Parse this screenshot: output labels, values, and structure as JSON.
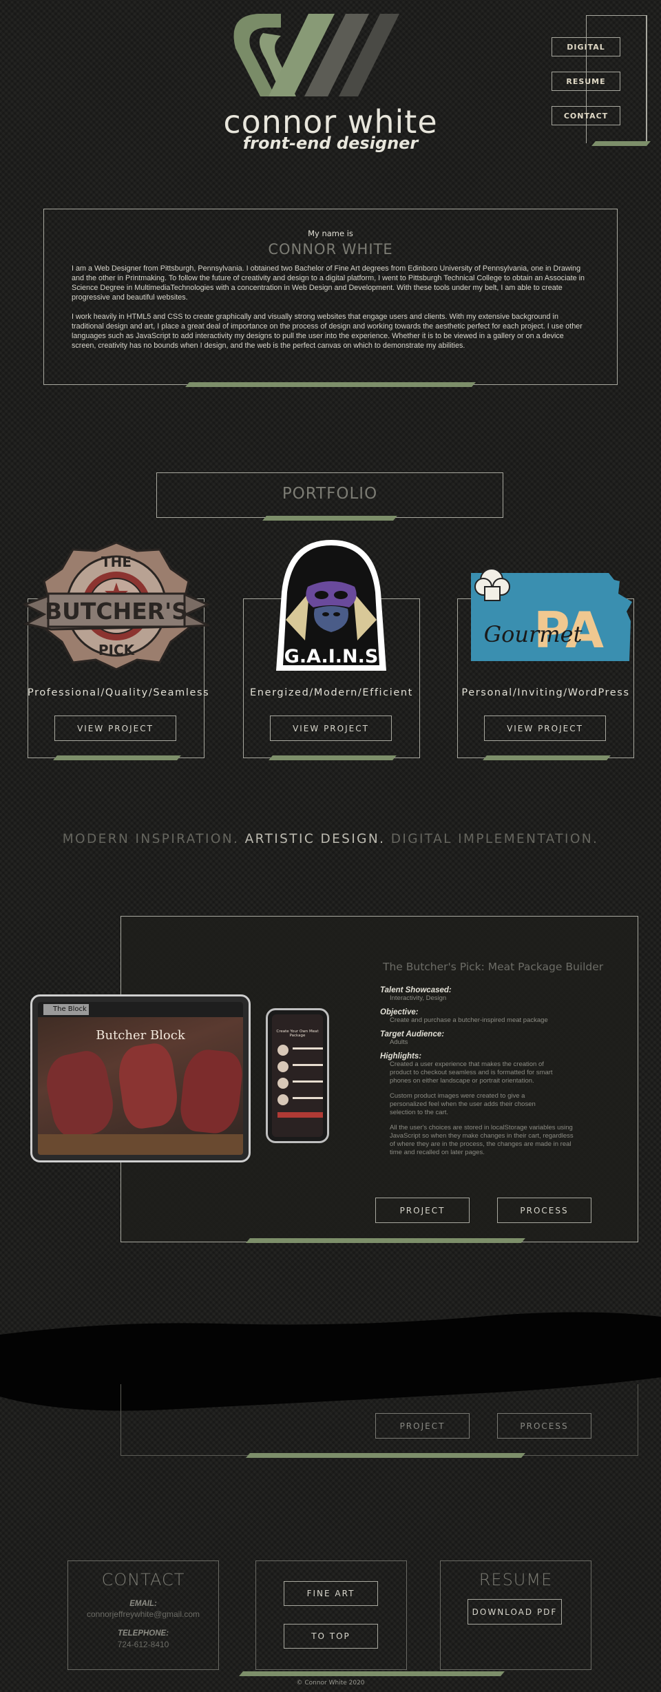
{
  "header": {
    "name": "connor white",
    "subtitle": "front-end designer",
    "nav": [
      "DIGITAL",
      "RESUME",
      "CONTACT"
    ]
  },
  "about": {
    "intro": "My name is",
    "name": "CONNOR WHITE",
    "paragraph1": "I am a Web Designer from Pittsburgh, Pennsylvania. I obtained two Bachelor of Fine Art degrees from Edinboro University of Pennsylvania, one in Drawing and the other in Printmaking. To follow the future of creativity and design to a digital platform, I went to Pittsburgh Technical College to obtain an Associate in Science Degree in MultimediaTechnologies with a concentration in Web Design and Development.  With these tools under my belt, I am able to create progressive and beautiful websites.",
    "paragraph2": "I work heavily in HTML5 and CSS to create graphically and visually strong websites that engage users and clients. With my extensive background in traditional design and art, I place a great deal of importance on the process of design and working towards the aesthetic perfect for each project. I use other languages such as JavaScript to add interactivity my designs to pull the user into the experience.  Whether it is to be viewed in a gallery or on a device screen, creativity has no bounds when I design, and the web is the perfect canvas on which to demonstrate my abilities."
  },
  "portfolio": {
    "heading": "PORTFOLIO",
    "cards": [
      {
        "logo_top": "THE",
        "logo_main": "BUTCHER'S",
        "logo_bottom": "PICK",
        "tagline": "Professional/Quality/Seamless",
        "button": "VIEW PROJECT"
      },
      {
        "logo_main": "G.A.I.N.S",
        "tagline": "Energized/Modern/Efficient",
        "button": "VIEW PROJECT"
      },
      {
        "logo_script": "Gourmet",
        "logo_main": "PA",
        "tagline": "Personal/Inviting/WordPress",
        "button": "VIEW PROJECT"
      }
    ]
  },
  "banner": {
    "part1": "MODERN INSPIRATION.",
    "part2": "ARTISTIC DESIGN.",
    "part3": "DIGITAL IMPLEMENTATION."
  },
  "featured": {
    "title": "The Butcher's Pick: Meat Package Builder",
    "talent_label": "Talent Showcased:",
    "talent": "Interactivity, Design",
    "objective_label": "Objective:",
    "objective": "Create and purchase a butcher-inspired meat package",
    "audience_label": "Target Audience:",
    "audience": "Adults",
    "highlights_label": "Highlights:",
    "highlight1": "Created a user experience that makes the creation of product to checkout seamless and is formatted for smart phones on either landscape or portrait orientation.",
    "highlight2": "Custom product images were created to give a personalized feel when the user adds their chosen selection to the cart.",
    "highlight3": "All the user's choices are stored in localStorage variables using JavaScript so when they make changes in their cart, regardless of where they are in the process, the changes are made in real time and recalled on later pages.",
    "project_button": "PROJECT",
    "process_button": "PROCESS",
    "tablet_tab": "The Block",
    "tablet_heading": "Butcher Block",
    "phone_heading": "Create Your Own Meat Package"
  },
  "second": {
    "project_button": "PROJECT",
    "process_button": "PROCESS"
  },
  "contact": {
    "heading": "CONTACT",
    "email_label": "EMAIL:",
    "email": "connorjeffreywhite@gmail.com",
    "phone_label": "TELEPHONE:",
    "phone": "724-612-8410",
    "fine_art": "FINE ART",
    "to_top": "TO TOP",
    "resume_heading": "RESUME",
    "download": "DOWNLOAD PDF"
  },
  "footer": {
    "copyright": "© Connor White 2020"
  },
  "colors": {
    "accent": "#7d8f6a",
    "background": "#1c1c1a",
    "border": "#a9a9a0",
    "butcher_red": "#b03a35",
    "gains_purple": "#6a4a9c",
    "pa_blue": "#3a8fb0"
  }
}
